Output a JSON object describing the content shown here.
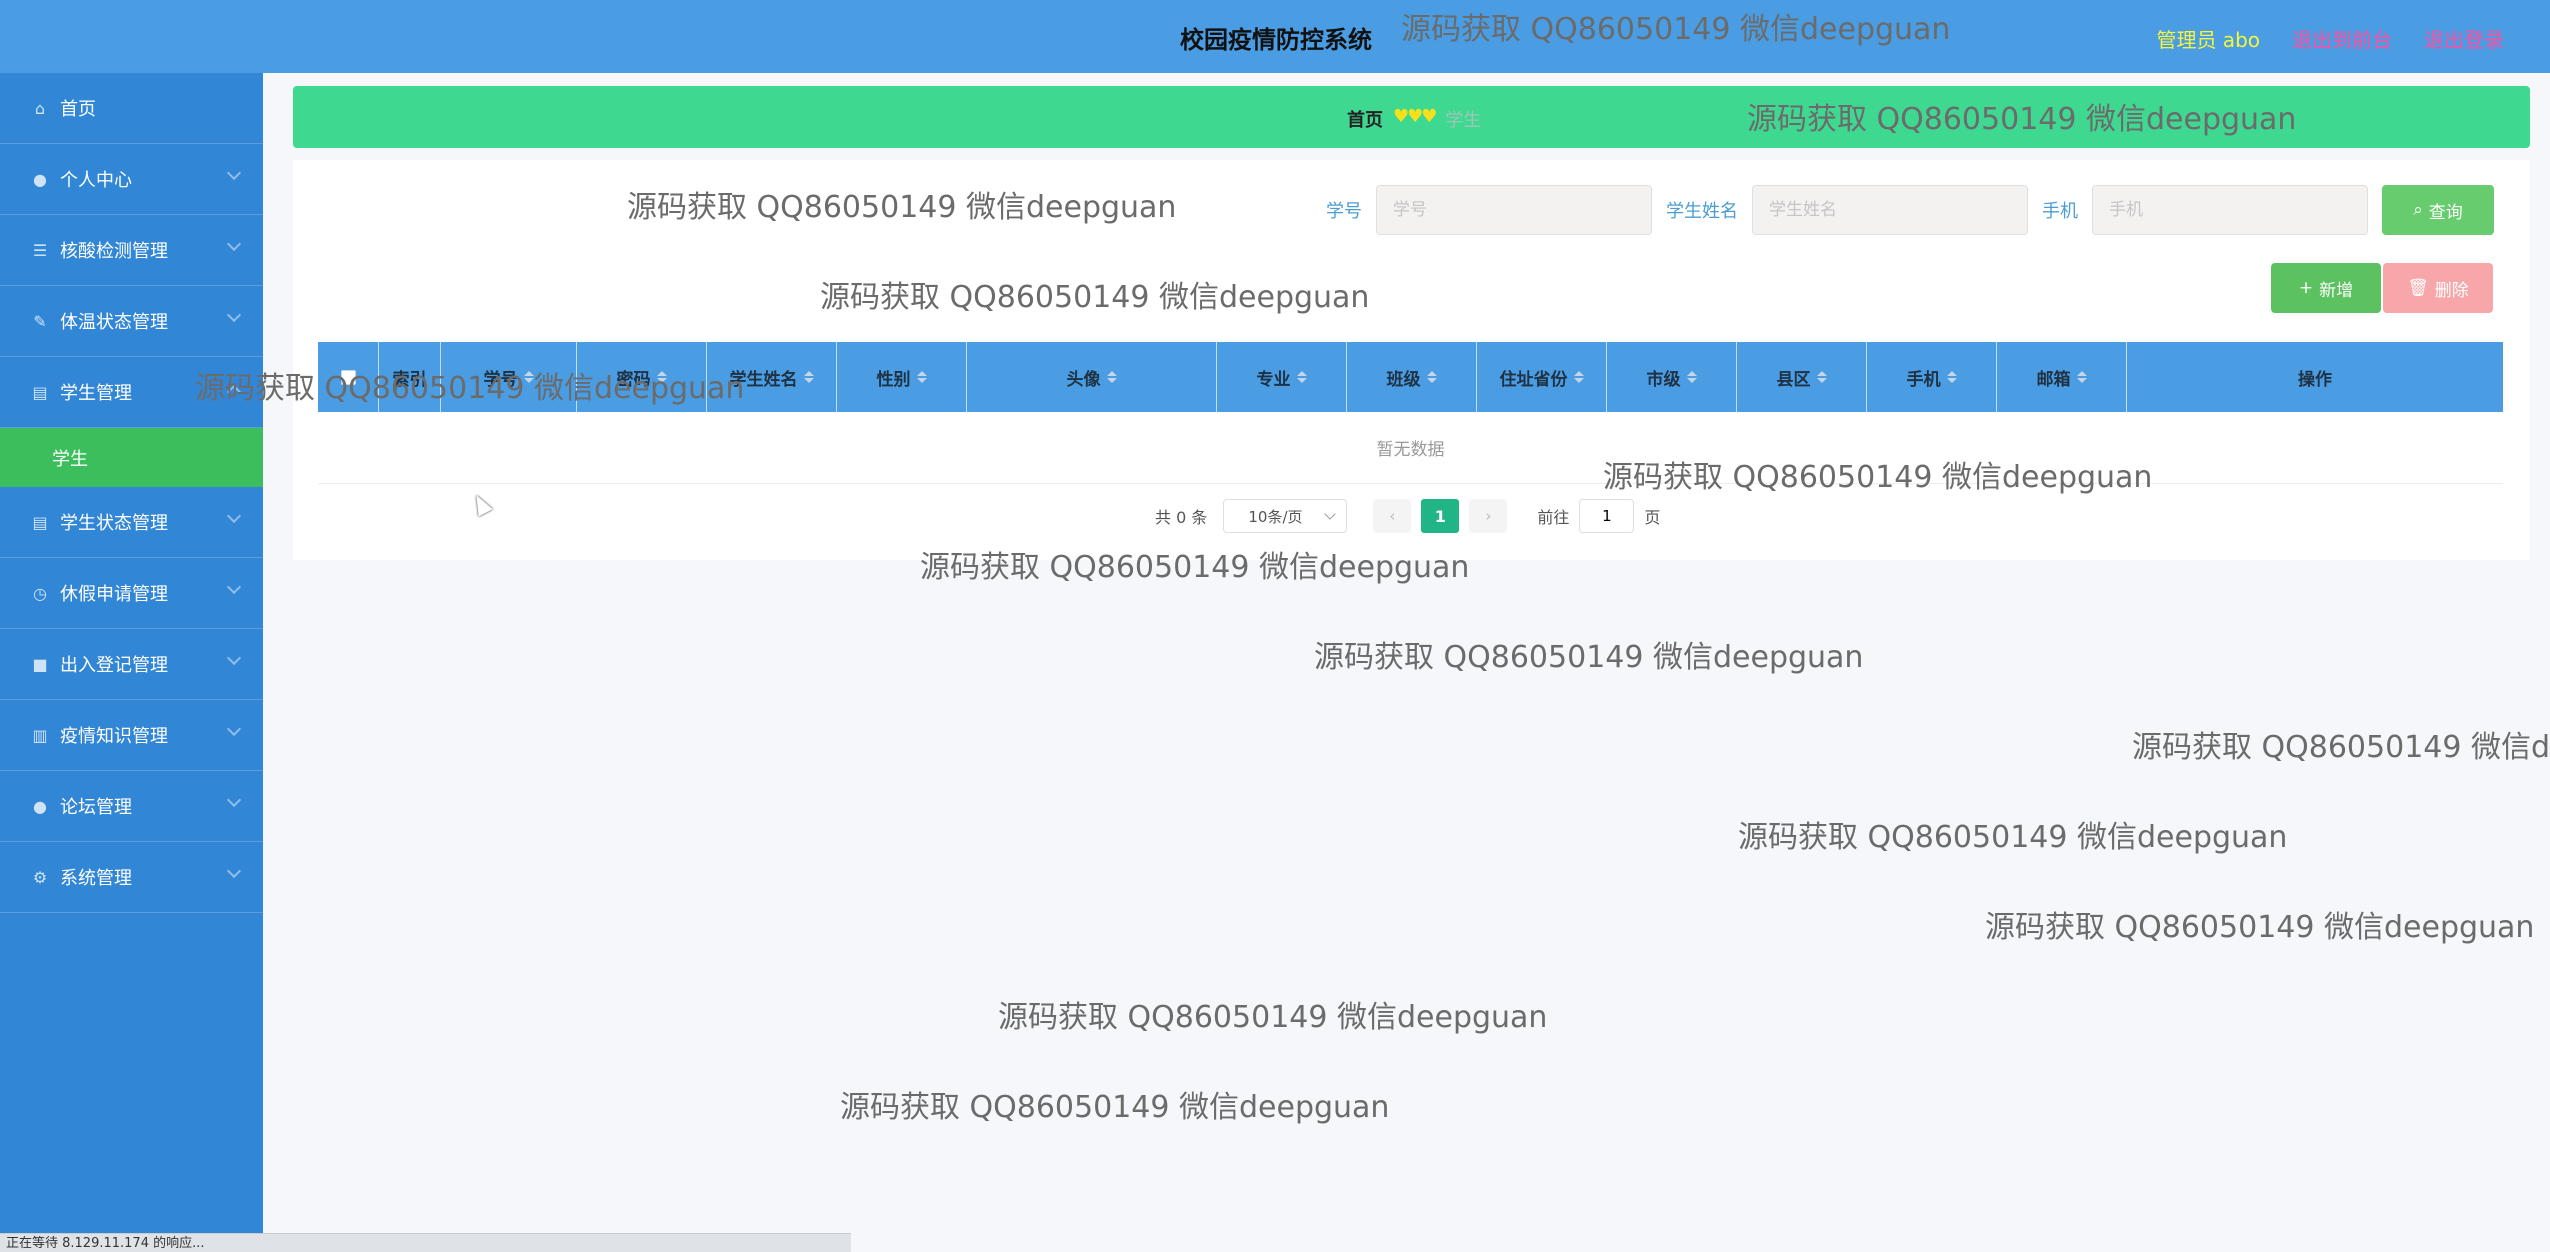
{
  "header": {
    "app_title": "校园疫情防控系统",
    "admin_label": "管理员 abo",
    "back_to_front": "退出到前台",
    "logout": "退出登录"
  },
  "sidebar": {
    "items": [
      {
        "label": "首页",
        "icon": "home-icon"
      },
      {
        "label": "个人中心",
        "icon": "user-icon"
      },
      {
        "label": "核酸检测管理",
        "icon": "sliders-icon"
      },
      {
        "label": "体温状态管理",
        "icon": "edit-icon"
      },
      {
        "label": "学生管理",
        "icon": "clipboard-icon"
      },
      {
        "label": "学生状态管理",
        "icon": "clipboard-icon"
      },
      {
        "label": "休假申请管理",
        "icon": "clock-icon"
      },
      {
        "label": "出入登记管理",
        "icon": "camera-icon"
      },
      {
        "label": "疫情知识管理",
        "icon": "chart-icon"
      },
      {
        "label": "论坛管理",
        "icon": "user-icon"
      },
      {
        "label": "系统管理",
        "icon": "gear-icon"
      }
    ],
    "sub_item": "学生"
  },
  "breadcrumb": {
    "home": "首页",
    "separator": "♥♥♥",
    "current": "学生"
  },
  "search": {
    "student_no_label": "学号",
    "student_no_placeholder": "学号",
    "student_name_label": "学生姓名",
    "student_name_placeholder": "学生姓名",
    "phone_label": "手机",
    "phone_placeholder": "手机",
    "query_button": "查询"
  },
  "actions": {
    "add_button": "新增",
    "delete_button": "删除"
  },
  "table": {
    "columns": [
      "索引",
      "学号",
      "密码",
      "学生姓名",
      "性别",
      "头像",
      "专业",
      "班级",
      "住址省份",
      "市级",
      "县区",
      "手机",
      "邮箱",
      "操作"
    ],
    "empty_text": "暂无数据"
  },
  "pagination": {
    "total_text": "共 0 条",
    "page_size": "10条/页",
    "current_page": "1",
    "goto_prefix": "前往",
    "goto_value": "1",
    "goto_suffix": "页"
  },
  "watermark_text": "源码获取 QQ86050149 微信deepguan",
  "status_bar": "正在等待 8.129.11.174 的响应...",
  "colors": {
    "header_bg": "#4a9de3",
    "sidebar_bg": "#3286d6",
    "active_sub_bg": "#3dbe5c",
    "breadcrumb_bg": "#3fd891",
    "query_btn": "#66cc6e",
    "add_btn": "#5cc25f",
    "delete_btn": "#f7a7a9",
    "page_active": "#21b585"
  }
}
